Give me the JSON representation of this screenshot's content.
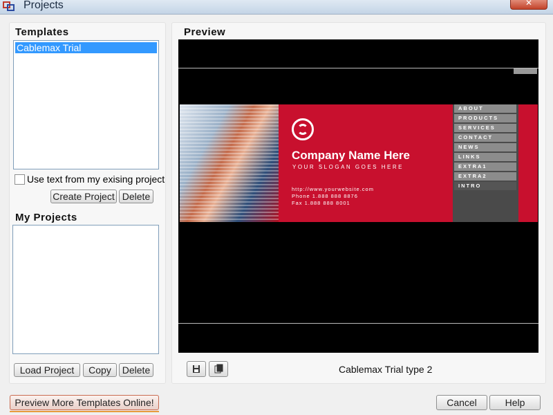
{
  "window": {
    "title": "Projects",
    "close_glyph": "✕"
  },
  "templates": {
    "label": "Templates",
    "items": [
      "Cablemax Trial"
    ],
    "checkbox_label": "Use text from my exising project",
    "checkbox_checked": false,
    "create_label": "Create Project",
    "delete_label": "Delete"
  },
  "my_projects": {
    "label": "My Projects",
    "items": [],
    "load_label": "Load Project",
    "copy_label": "Copy",
    "delete_label": "Delete"
  },
  "preview": {
    "label": "Preview",
    "caption": "Cablemax Trial type 2",
    "save_icon": "floppy-disk-icon",
    "copy_icon": "copy-pages-icon",
    "site": {
      "company_name": "Company Name Here",
      "slogan": "YOUR SLOGAN GOES HERE",
      "url": "http://www.yourwebsite.com",
      "phone": "Phone 1.888 888 8876",
      "fax": "Fax 1.888 888 8001",
      "nav": [
        "ABOUT",
        "PRODUCTS",
        "SERVICES",
        "CONTACT",
        "NEWS",
        "LINKS",
        "EXTRA1",
        "EXTRA2",
        "INTRO"
      ],
      "brand_color": "#c8102e"
    }
  },
  "footer": {
    "online_label": "Preview More Templates Online!",
    "cancel_label": "Cancel",
    "help_label": "Help"
  }
}
